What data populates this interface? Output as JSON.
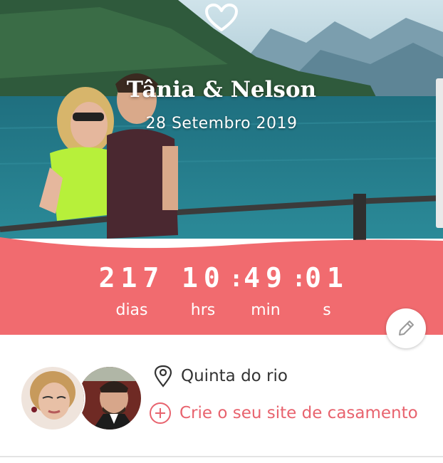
{
  "header": {
    "couple_names": "Tânia & Nelson",
    "date": "28 Setembro 2019"
  },
  "countdown": {
    "days": "217",
    "days_label": "dias",
    "hours": "10",
    "hours_label": "hrs",
    "minutes": "49",
    "minutes_label": "min",
    "seconds": "01",
    "seconds_label": "s"
  },
  "details": {
    "venue": "Quinta do rio",
    "create_site_link": "Crie o seu site de casamento"
  },
  "icons": [
    "heart-icon",
    "pencil-icon",
    "location-pin-icon",
    "plus-circle-icon"
  ],
  "colors": {
    "accent": "#f16b6f",
    "link": "#e8636e",
    "text": "#333333",
    "white": "#ffffff"
  }
}
